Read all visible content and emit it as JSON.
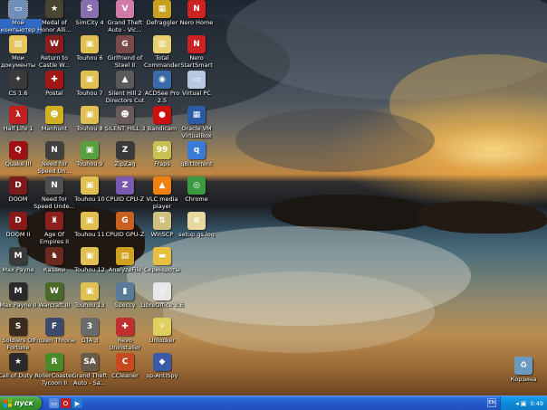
{
  "colors": {
    "start_green": "#3a9a31",
    "taskbar_blue": "#2459cb",
    "tray_blue": "#0f8ad8",
    "selection_blue": "#316ac5"
  },
  "icons": [
    {
      "label": "Мой\nкомпьютер",
      "icon": "my-computer-icon",
      "glyph": "▭",
      "color": "#6f8fb8",
      "selected": true
    },
    {
      "label": "Medal of\nHonor Alli...",
      "icon": "medal-of-honor-icon",
      "glyph": "★",
      "color": "#4a4530"
    },
    {
      "label": "SimCity 4",
      "icon": "simcity-icon",
      "glyph": "S",
      "color": "#8a6fb0"
    },
    {
      "label": "Grand Theft\nAuto - Vic...",
      "icon": "gta-vice-city-icon",
      "glyph": "V",
      "color": "#d07aa8"
    },
    {
      "label": "Defraggler",
      "icon": "defraggler-icon",
      "glyph": "▦",
      "color": "#c8a020"
    },
    {
      "label": "Nero Home",
      "icon": "nero-home-icon",
      "glyph": "N",
      "color": "#cc2222"
    },
    {
      "label": "Мои\nдокументы",
      "icon": "my-documents-icon",
      "glyph": "▤",
      "color": "#e6c560"
    },
    {
      "label": "Return to\nCastle W...",
      "icon": "castle-wolfenstein-icon",
      "glyph": "W",
      "color": "#8a1e1e"
    },
    {
      "label": "Touhou 6",
      "icon": "touhou-6-icon",
      "glyph": "▣",
      "color": "#e0c050"
    },
    {
      "label": "Girlfriend of\nSteel II",
      "icon": "girlfriend-of-steel-icon",
      "glyph": "G",
      "color": "#7a4a4a"
    },
    {
      "label": "Total\nCommander",
      "icon": "total-commander-icon",
      "glyph": "▥",
      "color": "#e8d070"
    },
    {
      "label": "Nero\nStartSmart",
      "icon": "nero-startsmart-icon",
      "glyph": "N",
      "color": "#cc2222"
    },
    {
      "label": "CS 1.6",
      "icon": "counter-strike-icon",
      "glyph": "✦",
      "color": "#3a3a3a"
    },
    {
      "label": "Postal",
      "icon": "postal-icon",
      "glyph": "✚",
      "color": "#a01818"
    },
    {
      "label": "Touhou 7",
      "icon": "touhou-7-icon",
      "glyph": "▣",
      "color": "#e0c050"
    },
    {
      "label": "Silent Hill 2\nDirectors Cut",
      "icon": "silent-hill-2-icon",
      "glyph": "▲",
      "color": "#5a5a5a"
    },
    {
      "label": "ACDSee Pro\n2.5",
      "icon": "acdsee-icon",
      "glyph": "◉",
      "color": "#3a6aa8"
    },
    {
      "label": "Virtual PC",
      "icon": "virtual-pc-icon",
      "glyph": "▭",
      "color": "#b8c8e0"
    },
    {
      "label": "Half Life 1",
      "icon": "half-life-icon",
      "glyph": "λ",
      "color": "#c02020"
    },
    {
      "label": "Manhunt",
      "icon": "manhunt-icon",
      "glyph": "☻",
      "color": "#d0b020"
    },
    {
      "label": "Touhou 8",
      "icon": "touhou-8-icon",
      "glyph": "▣",
      "color": "#e0c050"
    },
    {
      "label": "SILENT HILL 3",
      "icon": "silent-hill-3-icon",
      "glyph": "☻",
      "color": "#6a5a5a"
    },
    {
      "label": "Bandicam",
      "icon": "bandicam-icon",
      "glyph": "●",
      "color": "#cc1010"
    },
    {
      "label": "Oracle VM\nVirtualBox",
      "icon": "virtualbox-icon",
      "glyph": "▦",
      "color": "#2a5aa8"
    },
    {
      "label": "Quake III",
      "icon": "quake-3-icon",
      "glyph": "Q",
      "color": "#a01010"
    },
    {
      "label": "Need for\nSpeed Un...",
      "icon": "nfs-underground-icon",
      "glyph": "N",
      "color": "#404040"
    },
    {
      "label": "Touhou 9",
      "icon": "touhou-9-icon",
      "glyph": "▣",
      "color": "#58a040"
    },
    {
      "label": "ZipZag",
      "icon": "zipzag-icon",
      "glyph": "Z",
      "color": "#3a3a3a"
    },
    {
      "label": "Fraps",
      "icon": "fraps-icon",
      "glyph": "99",
      "color": "#c8c050"
    },
    {
      "label": "qBittorrent",
      "icon": "qbittorrent-icon",
      "glyph": "q",
      "color": "#3a7ad8"
    },
    {
      "label": "DOOM",
      "icon": "doom-icon",
      "glyph": "D",
      "color": "#7a1a1a"
    },
    {
      "label": "Need for\nSpeed Unde...",
      "icon": "nfs-underground-2-icon",
      "glyph": "N",
      "color": "#505050"
    },
    {
      "label": "Touhou 10",
      "icon": "touhou-10-icon",
      "glyph": "▣",
      "color": "#e0c050"
    },
    {
      "label": "CPUID CPU-Z",
      "icon": "cpu-z-icon",
      "glyph": "Z",
      "color": "#7a5ab0"
    },
    {
      "label": "VLC media\nplayer",
      "icon": "vlc-icon",
      "glyph": "▲",
      "color": "#f08010"
    },
    {
      "label": "Chrome",
      "icon": "chrome-icon",
      "glyph": "◎",
      "color": "#3a9a40"
    },
    {
      "label": "DOOM II",
      "icon": "doom-2-icon",
      "glyph": "D",
      "color": "#8a1a1a"
    },
    {
      "label": "Age Of\nEmpires II",
      "icon": "age-of-empires-icon",
      "glyph": "♜",
      "color": "#8a2020"
    },
    {
      "label": "Touhou 11",
      "icon": "touhou-11-icon",
      "glyph": "▣",
      "color": "#e0c050"
    },
    {
      "label": "CPUID GPU-Z",
      "icon": "gpu-z-icon",
      "glyph": "G",
      "color": "#c86020"
    },
    {
      "label": "WinSCP",
      "icon": "winscp-icon",
      "glyph": "⇅",
      "color": "#d0c080"
    },
    {
      "label": "setup.gs.log",
      "icon": "log-file-icon",
      "glyph": "≡",
      "color": "#e8d8a0"
    },
    {
      "label": "Max Payne",
      "icon": "max-payne-icon",
      "glyph": "M",
      "color": "#3a3a3a"
    },
    {
      "label": "Казаки",
      "icon": "cossacks-icon",
      "glyph": "♞",
      "color": "#6a2a20"
    },
    {
      "label": "Touhou 12",
      "icon": "touhou-12-icon",
      "glyph": "▣",
      "color": "#e0c050"
    },
    {
      "label": "AnalyzeFile",
      "icon": "analyzer-icon",
      "glyph": "▤",
      "color": "#d0a020"
    },
    {
      "label": "Скриншоты",
      "icon": "screenshots-folder-icon",
      "glyph": "▬",
      "color": "#e8c040"
    },
    {
      "label": "",
      "icon": "empty-slot",
      "glyph": "",
      "color": "transparent"
    },
    {
      "label": "Max Payne II",
      "icon": "max-payne-2-icon",
      "glyph": "M",
      "color": "#2a2a2a"
    },
    {
      "label": "Warcraft III",
      "icon": "warcraft-3-icon",
      "glyph": "W",
      "color": "#4a6a2a"
    },
    {
      "label": "Touhou 13",
      "icon": "touhou-13-icon",
      "glyph": "▣",
      "color": "#e0c050"
    },
    {
      "label": "Speccy",
      "icon": "speccy-icon",
      "glyph": "▮",
      "color": "#5a7a9a"
    },
    {
      "label": "LibreOffice 3.6",
      "icon": "libreoffice-icon",
      "glyph": "▯",
      "color": "#e8e8e8"
    },
    {
      "label": "",
      "icon": "empty-slot",
      "glyph": "",
      "color": "transparent"
    },
    {
      "label": "Soldiers Of\nFortune",
      "icon": "soldiers-of-fortune-icon",
      "glyph": "S",
      "color": "#3a2a20"
    },
    {
      "label": "Frozen Throne",
      "icon": "frozen-throne-icon",
      "glyph": "F",
      "color": "#3a4a6a"
    },
    {
      "label": "GTA 3",
      "icon": "gta-3-icon",
      "glyph": "3",
      "color": "#6a6a6a"
    },
    {
      "label": "Revo\nUninstaller",
      "icon": "revo-uninstaller-icon",
      "glyph": "✚",
      "color": "#c03030"
    },
    {
      "label": "Unlocker",
      "icon": "unlocker-icon",
      "glyph": "✧",
      "color": "#e0d060"
    },
    {
      "label": "",
      "icon": "empty-slot",
      "glyph": "",
      "color": "transparent"
    },
    {
      "label": "Call of Duty 1",
      "icon": "call-of-duty-icon",
      "glyph": "★",
      "color": "#2a2a2a"
    },
    {
      "label": "RollerCoaster\nTycoon II",
      "icon": "rollercoaster-tycoon-icon",
      "glyph": "R",
      "color": "#4a8a2a"
    },
    {
      "label": "Grand Theft\nAuto - Sa...",
      "icon": "gta-san-andreas-icon",
      "glyph": "SA",
      "color": "#6a5a4a"
    },
    {
      "label": "CCleaner",
      "icon": "ccleaner-icon",
      "glyph": "C",
      "color": "#c84820"
    },
    {
      "label": "sp-AntiSpy",
      "icon": "sp-antispy-icon",
      "glyph": "◆",
      "color": "#3a5aa8"
    },
    {
      "label": "",
      "icon": "empty-slot",
      "glyph": "",
      "color": "transparent"
    }
  ],
  "recycle_bin": {
    "label": "Корзина",
    "icon": "recycle-bin-icon",
    "glyph": "♻",
    "color": "#6a9ac0"
  },
  "taskbar": {
    "start_label": "пуск",
    "quick_launch": [
      {
        "icon": "show-desktop-icon",
        "glyph": "▭",
        "color": "#5a8ad8"
      },
      {
        "icon": "opera-icon",
        "glyph": "O",
        "color": "#c02020"
      },
      {
        "icon": "media-player-icon",
        "glyph": "▶",
        "color": "#2a7ad0"
      }
    ],
    "language": "EN",
    "clock": "0:49"
  }
}
